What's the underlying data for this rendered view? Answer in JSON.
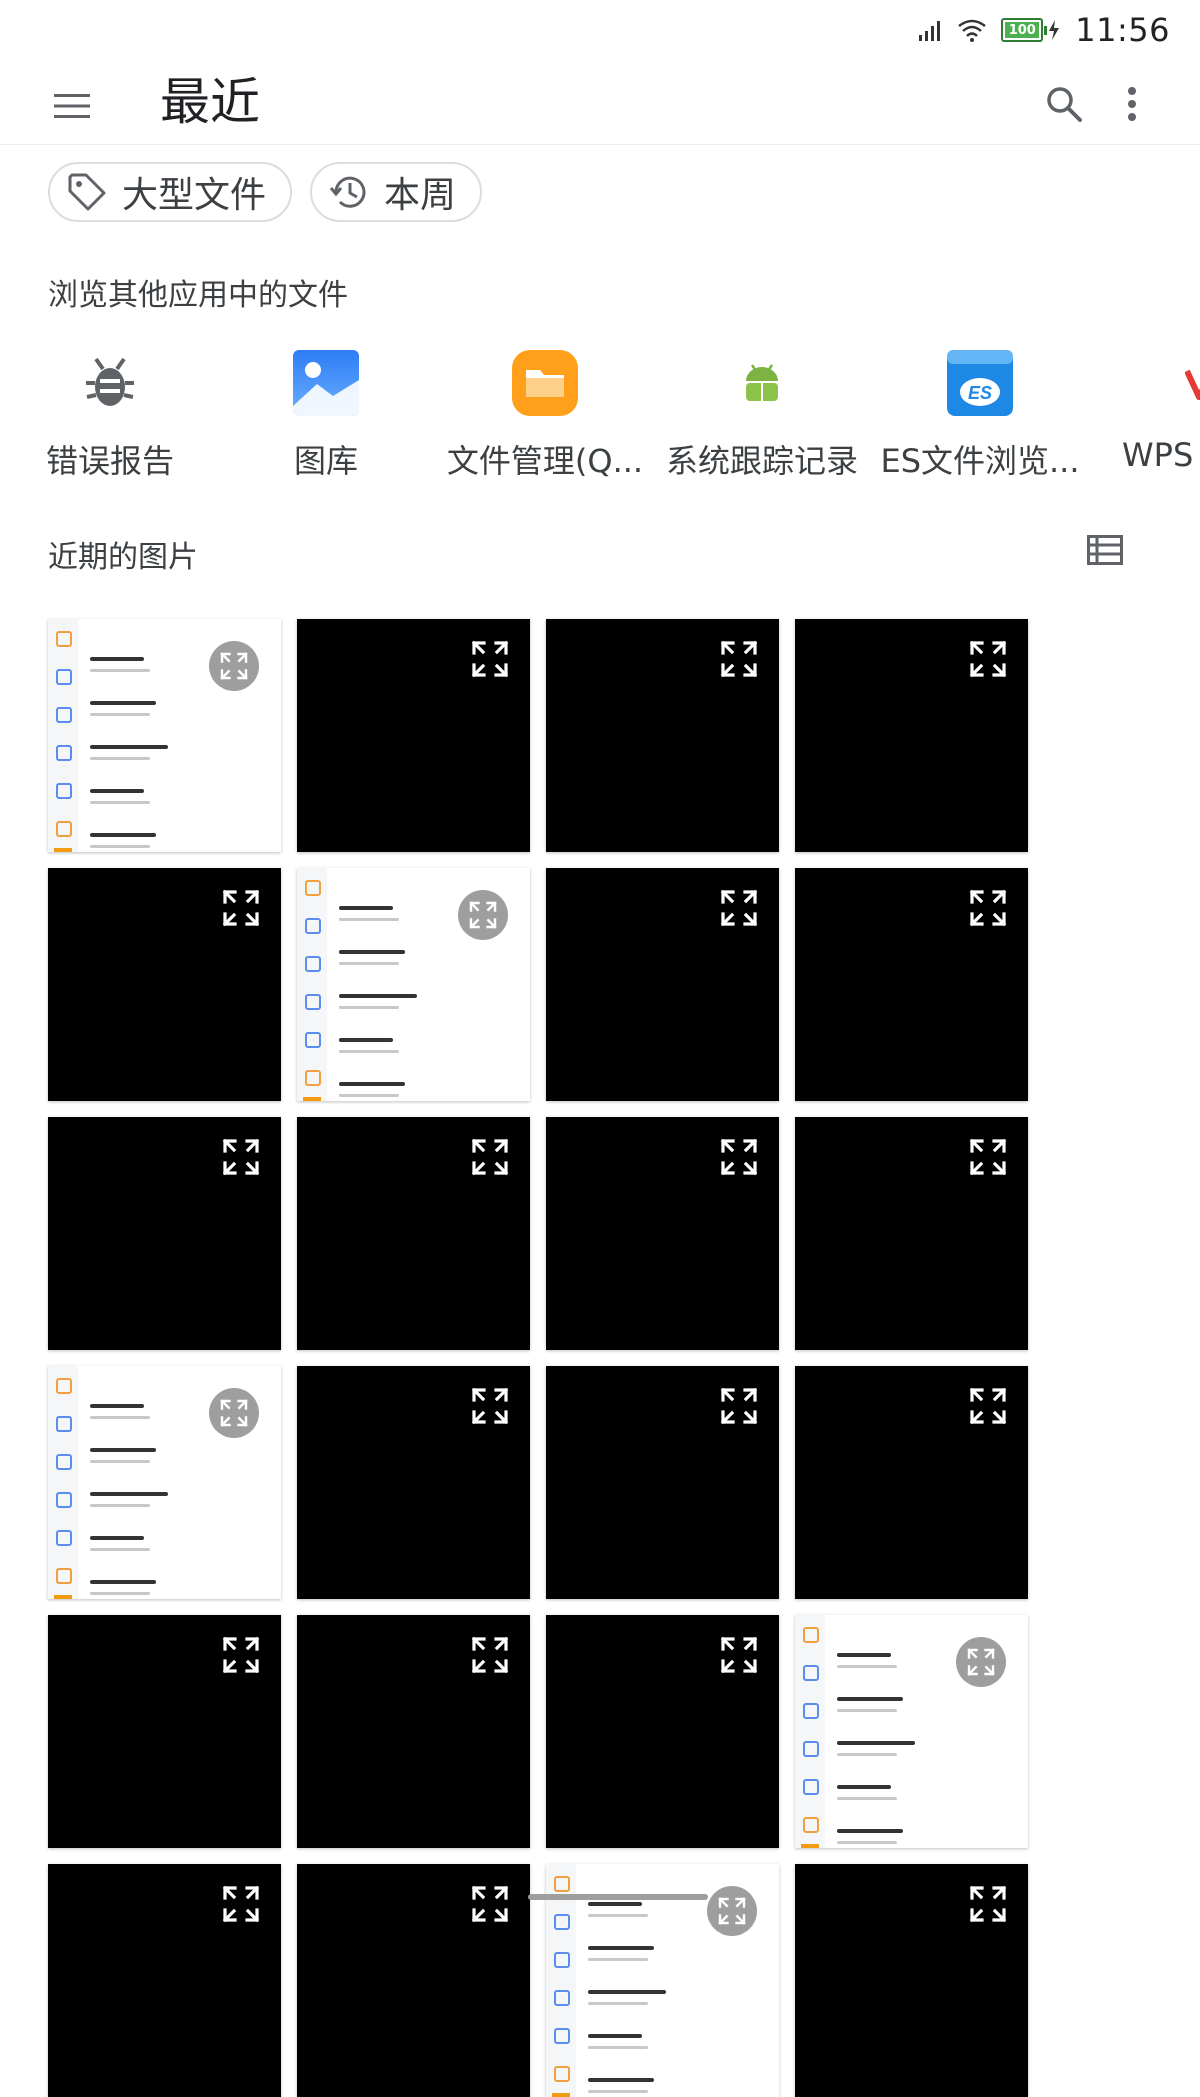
{
  "status_bar": {
    "time": "11:56",
    "battery": "100"
  },
  "app_bar": {
    "title": "最近"
  },
  "chips": [
    {
      "label": "大型文件",
      "icon": "tag-icon"
    },
    {
      "label": "本周",
      "icon": "history-icon"
    }
  ],
  "browse_section": {
    "title": "浏览其他应用中的文件"
  },
  "apps": [
    {
      "label": "错误报告",
      "icon": "bug-icon"
    },
    {
      "label": "图库",
      "icon": "gallery-icon"
    },
    {
      "label": "文件管理(Q...",
      "icon": "file-manager-icon"
    },
    {
      "label": "系统跟踪记录",
      "icon": "android-icon"
    },
    {
      "label": "ES文件浏览...",
      "icon": "es-file-icon"
    },
    {
      "label": "WPS O",
      "icon": "wps-icon"
    }
  ],
  "recent_images": {
    "title": "近期的图片",
    "tiles": [
      "screenshot",
      "black",
      "black",
      "black",
      "black",
      "screenshot",
      "black",
      "black",
      "black",
      "black",
      "black",
      "black",
      "screenshot",
      "black",
      "black",
      "black",
      "black",
      "black",
      "black",
      "screenshot",
      "black",
      "black",
      "screenshot",
      "black"
    ]
  },
  "colors": {
    "accent": "#1a73e8",
    "chip_border": "#dadce0"
  }
}
